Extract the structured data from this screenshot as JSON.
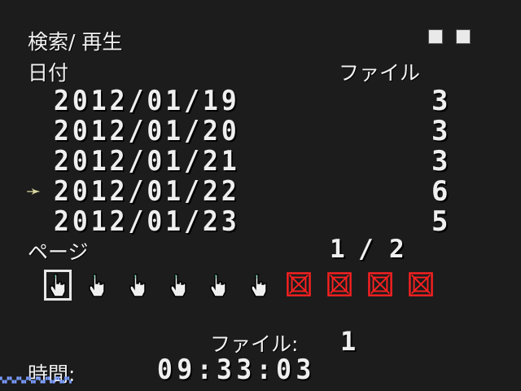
{
  "header": {
    "title": "検索/ 再生",
    "checkbox_count": 2
  },
  "columns": {
    "date": "日付",
    "files": "ファイル"
  },
  "rows": [
    {
      "date": "2012/01/19",
      "count": "3",
      "selected": false
    },
    {
      "date": "2012/01/20",
      "count": "3",
      "selected": false
    },
    {
      "date": "2012/01/21",
      "count": "3",
      "selected": false
    },
    {
      "date": "2012/01/22",
      "count": "6",
      "selected": true
    },
    {
      "date": "2012/01/23",
      "count": "5",
      "selected": false
    }
  ],
  "page": {
    "label": "ページ",
    "current": "1",
    "separator": "/",
    "total": "2"
  },
  "icons": [
    {
      "name": "hand-cursor-icon",
      "selected": true
    },
    {
      "name": "hand-cursor-icon",
      "selected": false
    },
    {
      "name": "hand-cursor-icon",
      "selected": false
    },
    {
      "name": "hand-cursor-icon",
      "selected": false
    },
    {
      "name": "hand-cursor-icon",
      "selected": false
    },
    {
      "name": "hand-cursor-icon",
      "selected": false
    },
    {
      "name": "disabled-x-icon",
      "selected": false
    },
    {
      "name": "disabled-x-icon",
      "selected": false
    },
    {
      "name": "disabled-x-icon",
      "selected": false
    },
    {
      "name": "disabled-x-icon",
      "selected": false
    }
  ],
  "footer": {
    "file_label": "ファイル:",
    "file_value": "1",
    "time_label": "時間:",
    "time_value": "09:33:03"
  },
  "colors": {
    "background": "#1c1c1c",
    "text": "#efefef",
    "disabled_red": "#ff2020"
  }
}
